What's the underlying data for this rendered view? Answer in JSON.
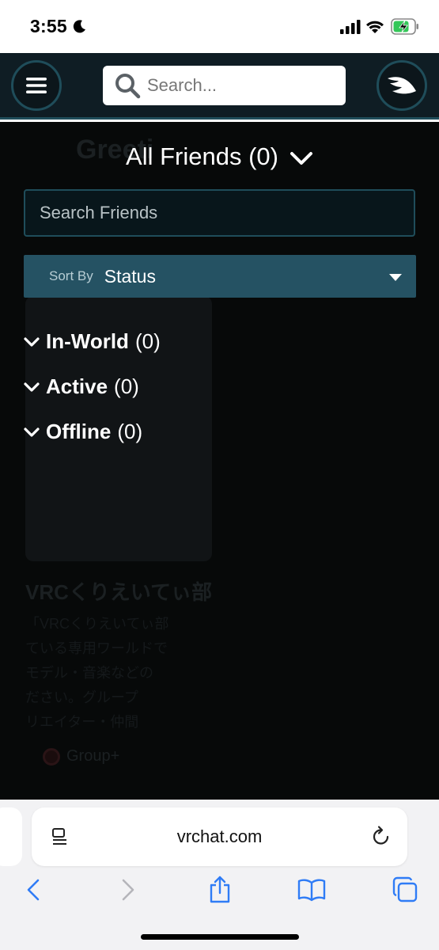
{
  "status_bar": {
    "time": "3:55"
  },
  "header": {
    "search_placeholder": "Search..."
  },
  "background_page": {
    "title_fragment": "Greeti",
    "heading_fragment": "VRCくりえいてぃ部",
    "lines": [
      "「VRCくりえいてぃ部",
      "ている専用ワールドで",
      "モデル・音楽などの",
      "ださい。グループ",
      "リエイター・仲間"
    ],
    "option_label": "Group+"
  },
  "friends": {
    "title": "All Friends (0)",
    "search_placeholder": "Search Friends",
    "sort_label": "Sort By",
    "sort_value": "Status",
    "groups": [
      {
        "name": "In-World",
        "count": "(0)"
      },
      {
        "name": "Active",
        "count": "(0)"
      },
      {
        "name": "Offline",
        "count": "(0)"
      }
    ]
  },
  "browser": {
    "url": "vrchat.com"
  },
  "colors": {
    "header_bg": "#0f1d24",
    "accent_border": "#1f4d5a",
    "sort_bar": "#255263",
    "ios_blue": "#2f7cf6"
  }
}
